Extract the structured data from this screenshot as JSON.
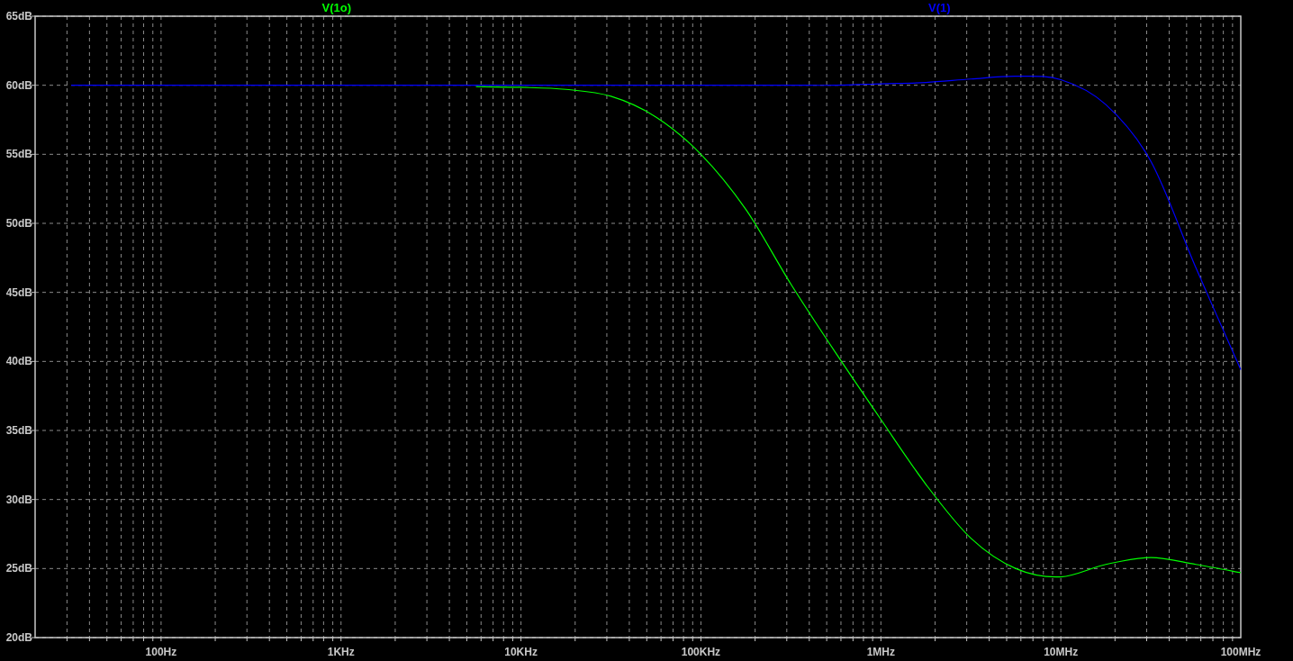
{
  "chart_data": {
    "type": "line",
    "grid": true,
    "categories": [
      null,
      null,
      "100Hz",
      null,
      null,
      null,
      "1KHz",
      null,
      null,
      null,
      "10KHz",
      null,
      null,
      null,
      "100KHz",
      null,
      null,
      null,
      "1MHz",
      null,
      null,
      null,
      "10MHz",
      null,
      null,
      null,
      "100MHz"
    ],
    "series": [
      {
        "name": "V(1o)",
        "color": "#00ff00",
        "values": [
          null,
          null,
          null,
          null,
          null,
          null,
          null,
          null,
          null,
          59.9,
          59.85,
          59.7,
          59.2,
          57.7,
          55.0,
          51.0,
          45.6,
          40.6,
          35.8,
          31.1,
          27.2,
          25.0,
          24.4,
          25.3,
          25.8,
          25.3,
          24.7
        ]
      },
      {
        "name": "V(1)",
        "color": "#0000ff",
        "values": [
          60,
          60,
          60,
          60,
          60,
          60,
          60,
          60,
          60,
          60,
          60,
          60,
          60,
          60,
          60,
          60,
          60,
          60,
          60.1,
          60.2,
          60.45,
          60.65,
          60.4,
          58.6,
          54.5,
          46.8,
          39.4
        ]
      }
    ],
    "ylim": [
      20,
      65
    ],
    "yticks": [
      {
        "value": 20,
        "label": "20dB"
      },
      {
        "value": 25,
        "label": "25dB"
      },
      {
        "value": 30,
        "label": "30dB"
      },
      {
        "value": 35,
        "label": "35dB"
      },
      {
        "value": 40,
        "label": "40dB"
      },
      {
        "value": 45,
        "label": "45dB"
      },
      {
        "value": 50,
        "label": "50dB"
      },
      {
        "value": 55,
        "label": "55dB"
      },
      {
        "value": 60,
        "label": "60dB"
      },
      {
        "value": 65,
        "label": "65dB"
      }
    ]
  }
}
